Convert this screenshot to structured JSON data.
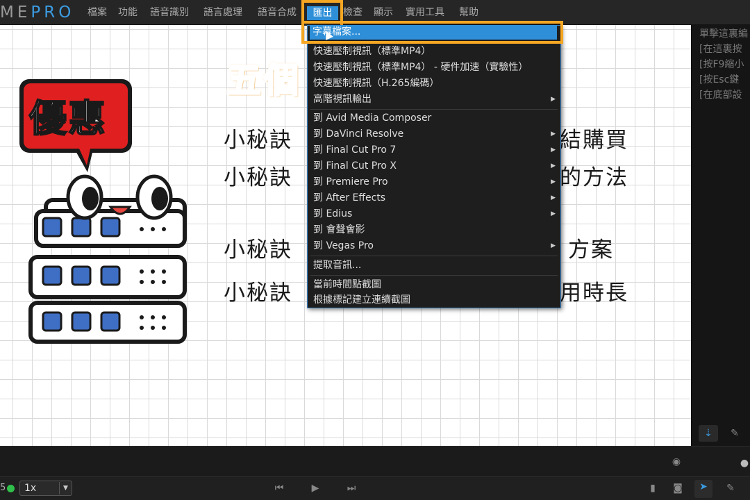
{
  "app": {
    "logo_me": "ME",
    "logo_pro": "PRO"
  },
  "menubar": {
    "items": [
      "檔案",
      "功能",
      "語音識別",
      "語言處理",
      "語音合成",
      "檢查",
      "顯示",
      "實用工具",
      "幫助"
    ],
    "export_label": "匯出"
  },
  "dropdown": {
    "subtitle_file": "字幕檔案...",
    "items": [
      {
        "label": "快速壓制視訊（標準MP4）",
        "submenu": false
      },
      {
        "label": "快速壓制視訊（標準MP4） - 硬件加速（實驗性）",
        "submenu": false
      },
      {
        "label": "快速壓制視訊（H.265編碼）",
        "submenu": false
      },
      {
        "label": "高階視訊輸出",
        "submenu": true
      },
      {
        "label": "到 Avid Media Composer",
        "submenu": false
      },
      {
        "label": "到 DaVinci Resolve",
        "submenu": true
      },
      {
        "label": "到 Final Cut Pro 7",
        "submenu": true
      },
      {
        "label": "到 Final Cut Pro X",
        "submenu": true
      },
      {
        "label": "到 Premiere Pro",
        "submenu": true
      },
      {
        "label": "到 After Effects",
        "submenu": true
      },
      {
        "label": "到 Edius",
        "submenu": true
      },
      {
        "label": "到 會聲會影",
        "submenu": false
      },
      {
        "label": "到 Vegas Pro",
        "submenu": true
      },
      {
        "label": "提取音訊...",
        "submenu": false
      },
      {
        "label": "當前時間點截圖",
        "submenu": false
      },
      {
        "label": "根據標記建立連續截圖",
        "submenu": false
      }
    ]
  },
  "canvas": {
    "badge_text": "優惠",
    "title_partial": "五個",
    "tips": [
      {
        "left": "小秘訣",
        "right": "結購買"
      },
      {
        "left": "小秘訣",
        "right": "的方法"
      },
      {
        "left": "小秘訣",
        "right": "方案"
      },
      {
        "left": "小秘訣",
        "right": "用時長"
      }
    ]
  },
  "right_panel": {
    "hints": [
      "單擊這裏編",
      "[在這裏按",
      "[按F9縮小",
      "[按Esc鍵",
      "[在底部設"
    ]
  },
  "statusbar": {
    "counter": "5",
    "speed": "1x"
  },
  "colors": {
    "accent": "#2e8fd8",
    "highlight_frame": "#f5a623",
    "badge_red": "#e02020"
  }
}
